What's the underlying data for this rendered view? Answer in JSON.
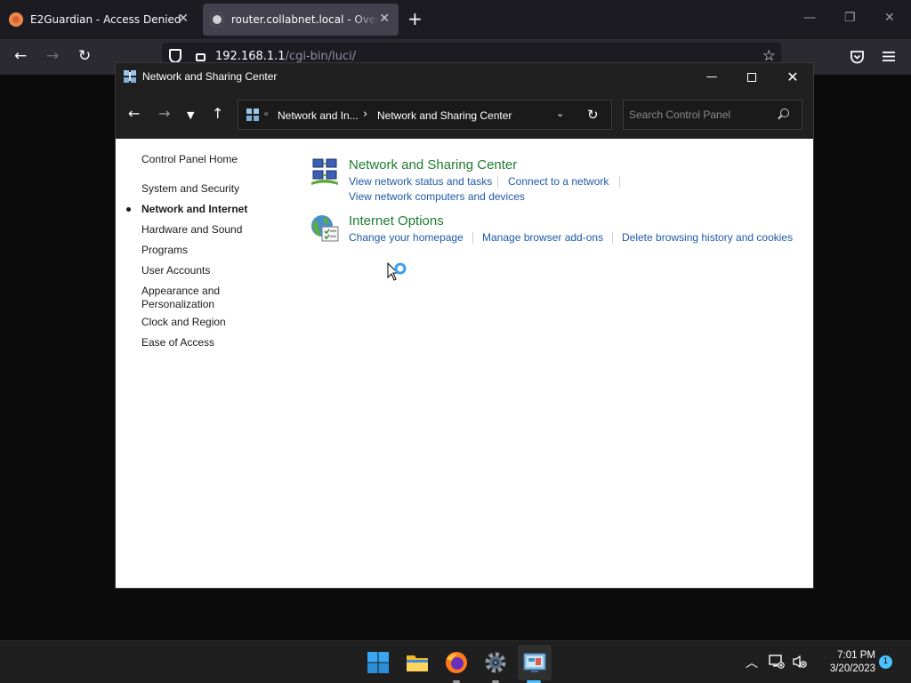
{
  "browser": {
    "tabs": [
      {
        "title": "E2Guardian - Access Denied"
      },
      {
        "title": "router.collabnet.local - Overview"
      }
    ],
    "url_host": "192.168.1.1",
    "url_path": "/cgi-bin/luci/"
  },
  "window": {
    "title": "Network and Sharing Center",
    "breadcrumb_prefix": "«",
    "breadcrumb": [
      "Network and In...",
      "Network and Sharing Center"
    ],
    "search_placeholder": "Search Control Panel"
  },
  "sidebar": {
    "items": [
      {
        "label": "Control Panel Home"
      },
      {
        "label": "System and Security"
      },
      {
        "label": "Network and Internet",
        "active": true
      },
      {
        "label": "Hardware and Sound"
      },
      {
        "label": "Programs"
      },
      {
        "label": "User Accounts"
      },
      {
        "label": "Appearance and Personalization"
      },
      {
        "label": "Clock and Region"
      },
      {
        "label": "Ease of Access"
      }
    ]
  },
  "categories": [
    {
      "title": "Network and Sharing Center",
      "icon": "network-sharing-icon",
      "links": [
        "View network status and tasks",
        "Connect to a network",
        "View network computers and devices"
      ]
    },
    {
      "title": "Internet Options",
      "icon": "internet-options-icon",
      "links": [
        "Change your homepage",
        "Manage browser add-ons",
        "Delete browsing history and cookies"
      ]
    }
  ],
  "taskbar": {
    "time": "7:01 PM",
    "date": "3/20/2023",
    "notification_count": "1"
  },
  "colors": {
    "category_title": "#1e7b2f",
    "link": "#1e5aa8",
    "accent": "#4cc2ff"
  }
}
